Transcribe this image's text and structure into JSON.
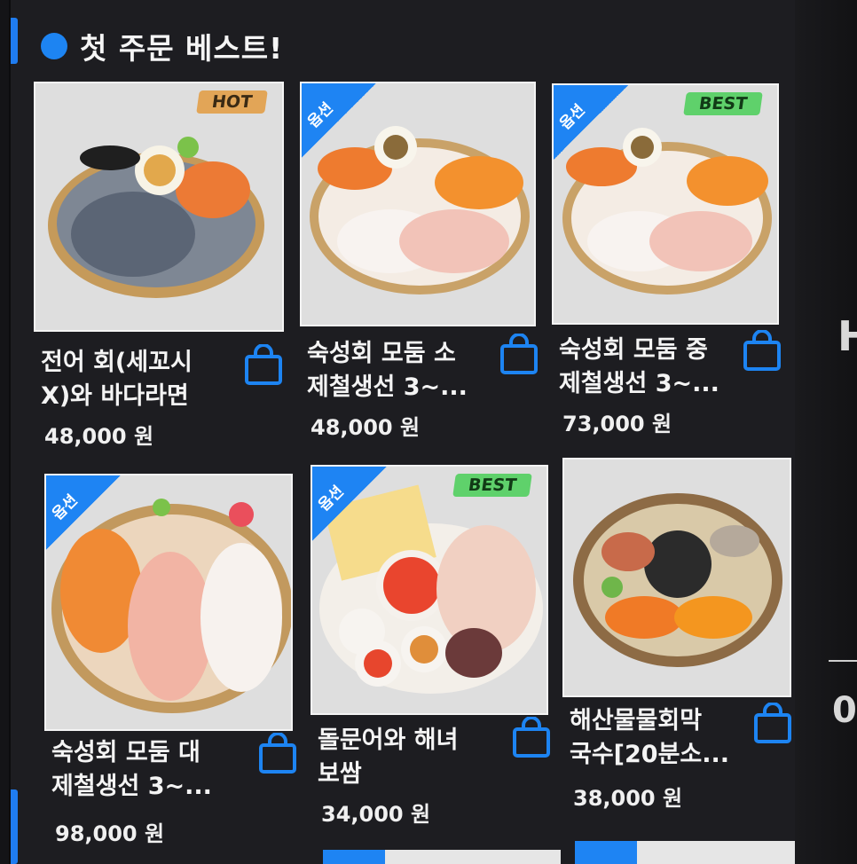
{
  "section": {
    "title": "첫 주문 베스트!"
  },
  "products": [
    {
      "name_line1": "전어 회(세꼬시",
      "name_line2": "X)와 바다라면",
      "price": "48,000 원",
      "badge": "HOT",
      "corner": ""
    },
    {
      "name_line1": "숙성회 모둠 소",
      "name_line2": "제철생선 3~...",
      "price": "48,000 원",
      "badge": "",
      "corner": "옵션"
    },
    {
      "name_line1": "숙성회 모둠 중",
      "name_line2": "제철생선 3~...",
      "price": "73,000 원",
      "badge": "BEST",
      "corner": "옵션"
    },
    {
      "name_line1": "숙성회 모둠 대",
      "name_line2": "제철생선 3~...",
      "price": "98,000 원",
      "badge": "",
      "corner": "옵션"
    },
    {
      "name_line1": "돌문어와 해녀",
      "name_line2": "보쌈",
      "price": "34,000 원",
      "badge": "BEST",
      "corner": "옵션"
    },
    {
      "name_line1": "해산물물회막",
      "name_line2": "국수[20분소...",
      "price": "38,000 원",
      "badge": "",
      "corner": ""
    }
  ],
  "edge": {
    "right_top": "H",
    "right_bottom": "0"
  },
  "colors": {
    "accent": "#1d84f2",
    "hot": "#e2a557",
    "best": "#5fd16b",
    "background": "#1d1d21"
  }
}
